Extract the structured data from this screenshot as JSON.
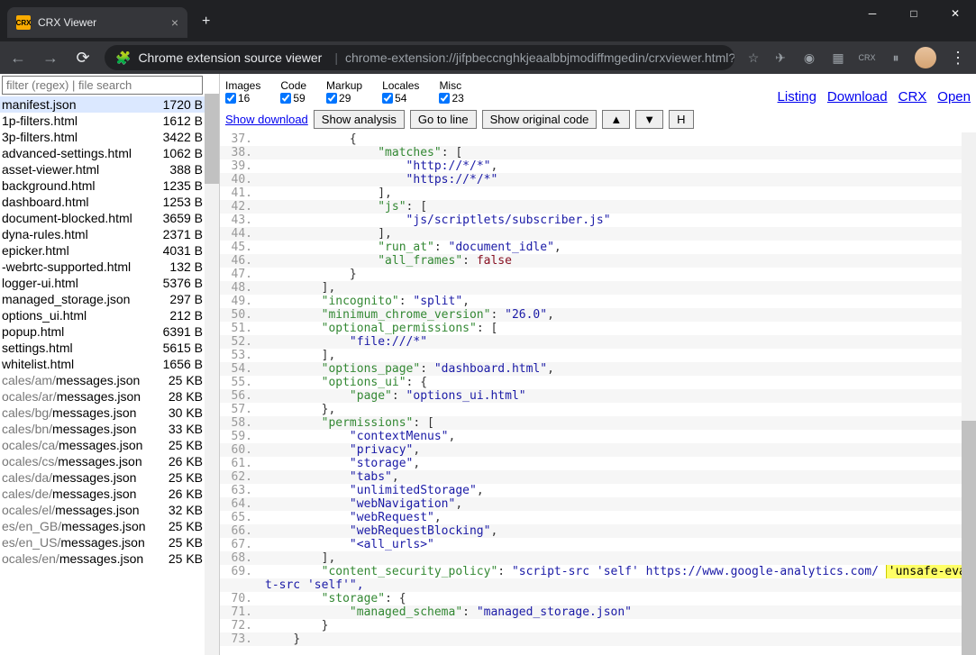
{
  "window": {
    "title": "CRX Viewer",
    "icon": "CRX"
  },
  "url": {
    "prefix": "Chrome extension source viewer",
    "path": "chrome-extension://jifpbeccnghkjeaalbbjmodiffmgedin/crxviewer.html?cr..."
  },
  "sidebar": {
    "search_placeholder": "filter (regex) | file search",
    "files": [
      {
        "name": "manifest.json",
        "dim": "",
        "size": "1720 B"
      },
      {
        "name": "1p-filters.html",
        "dim": "",
        "size": "1612 B"
      },
      {
        "name": "3p-filters.html",
        "dim": "",
        "size": "3422 B"
      },
      {
        "name": "advanced-settings.html",
        "dim": "",
        "size": "1062 B"
      },
      {
        "name": "asset-viewer.html",
        "dim": "",
        "size": "388 B"
      },
      {
        "name": "background.html",
        "dim": "",
        "size": "1235 B"
      },
      {
        "name": "dashboard.html",
        "dim": "",
        "size": "1253 B"
      },
      {
        "name": "document-blocked.html",
        "dim": "",
        "size": "3659 B"
      },
      {
        "name": "dyna-rules.html",
        "dim": "",
        "size": "2371 B"
      },
      {
        "name": "epicker.html",
        "dim": "",
        "size": "4031 B"
      },
      {
        "name": "-webrtc-supported.html",
        "dim": "",
        "size": "132 B"
      },
      {
        "name": "logger-ui.html",
        "dim": "",
        "size": "5376 B"
      },
      {
        "name": "managed_storage.json",
        "dim": "",
        "size": "297 B"
      },
      {
        "name": "options_ui.html",
        "dim": "",
        "size": "212 B"
      },
      {
        "name": "popup.html",
        "dim": "",
        "size": "6391 B"
      },
      {
        "name": "settings.html",
        "dim": "",
        "size": "5615 B"
      },
      {
        "name": "whitelist.html",
        "dim": "",
        "size": "1656 B"
      },
      {
        "name": "messages.json",
        "dim": "cales/am/",
        "size": "25 KB"
      },
      {
        "name": "messages.json",
        "dim": "ocales/ar/",
        "size": "28 KB"
      },
      {
        "name": "messages.json",
        "dim": "cales/bg/",
        "size": "30 KB"
      },
      {
        "name": "messages.json",
        "dim": "cales/bn/",
        "size": "33 KB"
      },
      {
        "name": "messages.json",
        "dim": "ocales/ca/",
        "size": "25 KB"
      },
      {
        "name": "messages.json",
        "dim": "ocales/cs/",
        "size": "26 KB"
      },
      {
        "name": "messages.json",
        "dim": "cales/da/",
        "size": "25 KB"
      },
      {
        "name": "messages.json",
        "dim": "cales/de/",
        "size": "26 KB"
      },
      {
        "name": "messages.json",
        "dim": "ocales/el/",
        "size": "32 KB"
      },
      {
        "name": "messages.json",
        "dim": "es/en_GB/",
        "size": "25 KB"
      },
      {
        "name": "messages.json",
        "dim": "es/en_US/",
        "size": "25 KB"
      },
      {
        "name": "messages.json",
        "dim": "ocales/en/",
        "size": "25 KB"
      }
    ]
  },
  "stats": [
    {
      "label": "Images",
      "val": "16"
    },
    {
      "label": "Code",
      "val": "59"
    },
    {
      "label": "Markup",
      "val": "29"
    },
    {
      "label": "Locales",
      "val": "54"
    },
    {
      "label": "Misc",
      "val": "23"
    }
  ],
  "links": {
    "listing": "Listing",
    "download": "Download",
    "crx": "CRX",
    "open": "Open"
  },
  "subbar": {
    "show_dl": "Show download",
    "analysis": "Show analysis",
    "gotoline": "Go to line",
    "orig": "Show original code",
    "up": "▲",
    "down": "▼",
    "h": "H"
  },
  "code": [
    {
      "n": "37",
      "t": "            {",
      "c": ""
    },
    {
      "n": "38",
      "t": "                \"matches\": [",
      "c": "kv"
    },
    {
      "n": "39",
      "t": "                    \"http://*/*\",",
      "c": "s"
    },
    {
      "n": "40",
      "t": "                    \"https://*/*\"",
      "c": "s"
    },
    {
      "n": "41",
      "t": "                ],",
      "c": ""
    },
    {
      "n": "42",
      "t": "                \"js\": [",
      "c": "kv"
    },
    {
      "n": "43",
      "t": "                    \"js/scriptlets/subscriber.js\"",
      "c": "s"
    },
    {
      "n": "44",
      "t": "                ],",
      "c": ""
    },
    {
      "n": "45",
      "t": "                \"run_at\": \"document_idle\",",
      "c": "kvs"
    },
    {
      "n": "46",
      "t": "                \"all_frames\": false",
      "c": "kvl"
    },
    {
      "n": "47",
      "t": "            }",
      "c": ""
    },
    {
      "n": "48",
      "t": "        ],",
      "c": ""
    },
    {
      "n": "49",
      "t": "        \"incognito\": \"split\",",
      "c": "kvs"
    },
    {
      "n": "50",
      "t": "        \"minimum_chrome_version\": \"26.0\",",
      "c": "kvs"
    },
    {
      "n": "51",
      "t": "        \"optional_permissions\": [",
      "c": "kv"
    },
    {
      "n": "52",
      "t": "            \"file:///*\"",
      "c": "s"
    },
    {
      "n": "53",
      "t": "        ],",
      "c": ""
    },
    {
      "n": "54",
      "t": "        \"options_page\": \"dashboard.html\",",
      "c": "kvs"
    },
    {
      "n": "55",
      "t": "        \"options_ui\": {",
      "c": "kv"
    },
    {
      "n": "56",
      "t": "            \"page\": \"options_ui.html\"",
      "c": "kvs"
    },
    {
      "n": "57",
      "t": "        },",
      "c": ""
    },
    {
      "n": "58",
      "t": "        \"permissions\": [",
      "c": "kv"
    },
    {
      "n": "59",
      "t": "            \"contextMenus\",",
      "c": "s"
    },
    {
      "n": "60",
      "t": "            \"privacy\",",
      "c": "s"
    },
    {
      "n": "61",
      "t": "            \"storage\",",
      "c": "s"
    },
    {
      "n": "62",
      "t": "            \"tabs\",",
      "c": "s"
    },
    {
      "n": "63",
      "t": "            \"unlimitedStorage\",",
      "c": "s"
    },
    {
      "n": "64",
      "t": "            \"webNavigation\",",
      "c": "s"
    },
    {
      "n": "65",
      "t": "            \"webRequest\",",
      "c": "s"
    },
    {
      "n": "66",
      "t": "            \"webRequestBlocking\",",
      "c": "s"
    },
    {
      "n": "67",
      "t": "            \"<all_urls>\"",
      "c": "s"
    },
    {
      "n": "68",
      "t": "        ],",
      "c": ""
    },
    {
      "n": "69",
      "t": "CSP",
      "c": "csp"
    },
    {
      "n": "",
      "t": "t-src 'self'\",",
      "c": "wrap"
    },
    {
      "n": "70",
      "t": "        \"storage\": {",
      "c": "kv"
    },
    {
      "n": "71",
      "t": "            \"managed_schema\": \"managed_storage.json\"",
      "c": "kvs"
    },
    {
      "n": "72",
      "t": "        }",
      "c": ""
    },
    {
      "n": "73",
      "t": "    }",
      "c": ""
    }
  ],
  "csp": {
    "key": "\"content_security_policy\"",
    "pre": "\"script-src 'self' https://www.google-analytics.com/ ",
    "hl": "'unsafe-eval'",
    "post": " ; objec"
  }
}
